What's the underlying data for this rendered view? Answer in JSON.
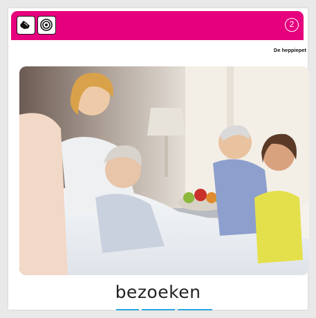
{
  "header": {
    "page_number": "2",
    "series_title": "De heppiepet",
    "icons": [
      "hand-icon",
      "spiral-icon"
    ],
    "banner_color": "#e6007e"
  },
  "illustration": {
    "subject": "hospital-visit-photo"
  },
  "word": {
    "text": "bezoeken",
    "underline_color": "#29a8e0"
  }
}
